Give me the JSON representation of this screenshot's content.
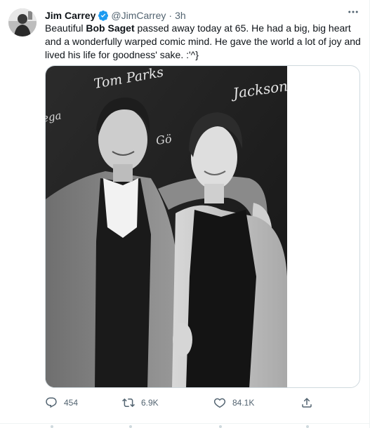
{
  "author": {
    "name": "Jim Carrey",
    "handle": "@JimCarrey",
    "separator": "·",
    "time": "3h"
  },
  "tweet": {
    "text_before": "Beautiful ",
    "text_bold": "Bob Saget",
    "text_after": " passed away today at 65. He had a big, big heart and a wonderfully warped comic mind. He gave the world a lot of joy and lived his life for goodness' sake. :'^}"
  },
  "photo": {
    "backdrop_signs": [
      "Tom Parks",
      "Jackson",
      "Gö",
      "ega"
    ]
  },
  "actions": {
    "reply_count": "454",
    "retweet_count": "6.9K",
    "like_count": "84.1K"
  },
  "icons": {
    "more": "more-icon",
    "verified": "verified-badge-icon",
    "reply": "reply-icon",
    "retweet": "retweet-icon",
    "like": "heart-icon",
    "share": "share-icon"
  },
  "colors": {
    "verified": "#1d9bf0",
    "secondary_text": "#536471"
  }
}
